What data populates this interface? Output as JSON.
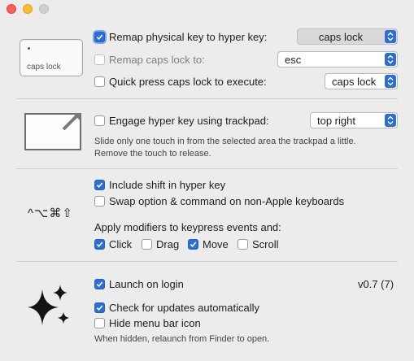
{
  "window": {
    "traffic_lights": [
      "close",
      "minimize",
      "zoom"
    ]
  },
  "remap": {
    "key_icon_label": "caps lock",
    "remap_physical": {
      "label": "Remap physical key to hyper key:",
      "checked": true,
      "value": "caps lock"
    },
    "remap_caps": {
      "label": "Remap caps lock to:",
      "checked": false,
      "value": "esc"
    },
    "quick_press": {
      "label": "Quick press caps lock to execute:",
      "checked": false,
      "value": "caps lock"
    }
  },
  "trackpad": {
    "engage": {
      "label": "Engage hyper key using trackpad:",
      "checked": false,
      "value": "top right"
    },
    "help_line1": "Slide only one touch in from the selected area the trackpad a little.",
    "help_line2": "Remove the touch to release."
  },
  "modifiers": {
    "symbols": "^⌥⌘⇧",
    "include_shift": {
      "label": "Include shift in hyper key",
      "checked": true
    },
    "swap_option": {
      "label": "Swap option & command on non-Apple keyboards",
      "checked": false
    },
    "apply_label": "Apply modifiers to keypress events and:",
    "click": {
      "label": "Click",
      "checked": true
    },
    "drag": {
      "label": "Drag",
      "checked": false
    },
    "move": {
      "label": "Move",
      "checked": true
    },
    "scroll": {
      "label": "Scroll",
      "checked": false
    }
  },
  "general": {
    "launch": {
      "label": "Launch on login",
      "checked": true
    },
    "version": "v0.7 (7)",
    "check_updates": {
      "label": "Check for updates automatically",
      "checked": true
    },
    "hide_icon": {
      "label": "Hide menu bar icon",
      "checked": false
    },
    "hide_note": "When hidden, relaunch from Finder to open."
  },
  "colors": {
    "accent": "#2a6ed6",
    "window_bg": "#ececec"
  }
}
